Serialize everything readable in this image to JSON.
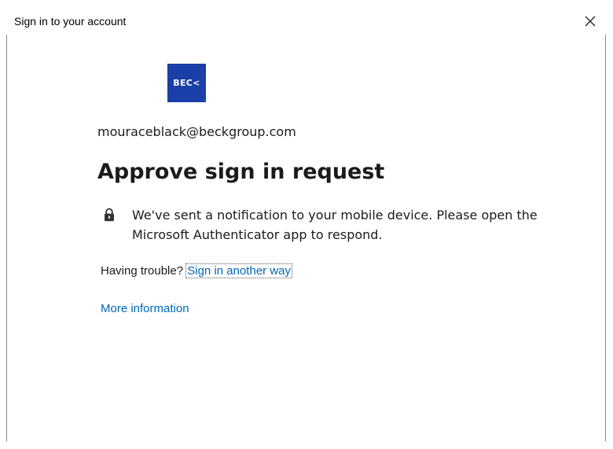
{
  "window": {
    "title": "Sign in to your account",
    "close_icon": "close-icon"
  },
  "logo": {
    "text": "BEC<",
    "color": "#1b3fa8"
  },
  "account": {
    "email": "mouraceblack@beckgroup.com"
  },
  "main": {
    "heading": "Approve sign in request",
    "notice_icon": "lock-icon",
    "notice_text": "We've sent a notification to your mobile device. Please open the Microsoft Authenticator app to respond."
  },
  "trouble": {
    "prompt": "Having trouble?",
    "link_label": "Sign in another way"
  },
  "more_info": {
    "label": "More information"
  },
  "colors": {
    "link": "#0067b8",
    "text": "#1b1b1b"
  }
}
